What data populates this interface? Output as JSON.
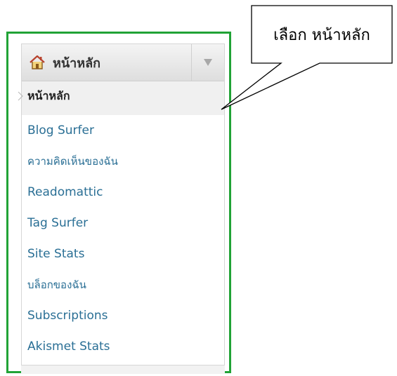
{
  "callout": {
    "text": "เลือก หน้าหลัก"
  },
  "menu": {
    "header_label": "หน้าหลัก",
    "header_icon": "home-icon",
    "toggle_icon": "chevron-down-icon",
    "items": [
      {
        "label": "หน้าหลัก",
        "active": true
      },
      {
        "label": "Blog Surfer"
      },
      {
        "label": "ความคิดเห็นของฉัน"
      },
      {
        "label": "Readomattic"
      },
      {
        "label": "Tag Surfer"
      },
      {
        "label": "Site Stats"
      },
      {
        "label": "บล็อกของฉัน"
      },
      {
        "label": "Subscriptions"
      },
      {
        "label": "Akismet Stats"
      }
    ]
  },
  "colors": {
    "highlight_frame": "#21a336",
    "link_text": "#2a6f95",
    "active_text": "#222222"
  }
}
